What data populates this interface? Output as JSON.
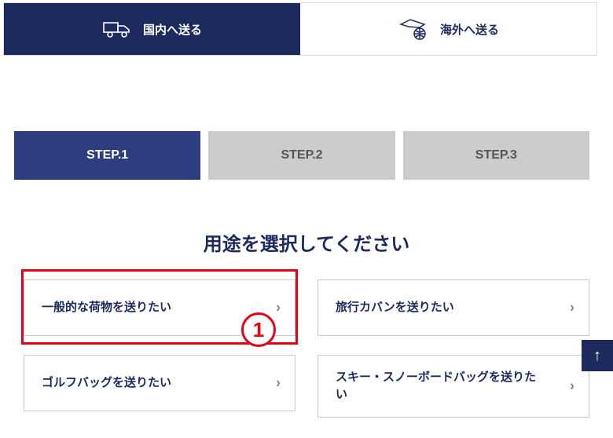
{
  "tabs": {
    "domestic": "国内へ送る",
    "international": "海外へ送る"
  },
  "steps": [
    "STEP.1",
    "STEP.2",
    "STEP.3"
  ],
  "heading": "用途を選択してください",
  "options": [
    {
      "label": "一般的な荷物を送りたい"
    },
    {
      "label": "旅行カバンを送りたい"
    },
    {
      "label": "ゴルフバッグを送りたい"
    },
    {
      "label": "スキー・スノーボードバッグを送りたい"
    }
  ],
  "annotation": {
    "number": "1"
  },
  "colors": {
    "brand": "#1c2a5e",
    "highlight": "#e60012"
  }
}
